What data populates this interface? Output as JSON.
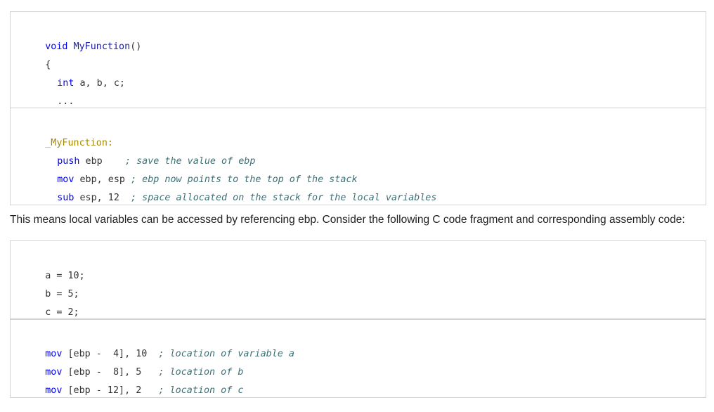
{
  "block1": {
    "line1": {
      "kw": "void",
      "fn": "MyFunction",
      "rest": "()"
    },
    "line2": "{",
    "line3": {
      "kw": "int",
      "rest": " a, b, c;"
    },
    "line4": "..."
  },
  "block2": {
    "label": "_MyFunction:",
    "lines": [
      {
        "op": "push",
        "args": " ebp    ",
        "comment": "; save the value of ebp"
      },
      {
        "op": "mov",
        "args": " ebp, esp ",
        "comment": "; ebp now points to the top of the stack"
      },
      {
        "op": "sub",
        "args": " esp, 12  ",
        "comment": "; space allocated on the stack for the local variables"
      }
    ]
  },
  "paragraph": "This means local variables can be accessed by referencing ebp. Consider the following C code fragment and corresponding assembly code:",
  "block3": {
    "lines": [
      {
        "var": "a",
        "eq": " = ",
        "val": "10;"
      },
      {
        "var": "b",
        "eq": " = ",
        "val": "5;"
      },
      {
        "var": "c",
        "eq": " = ",
        "val": "2;"
      }
    ]
  },
  "block4": {
    "lines": [
      {
        "op": "mov",
        "args": " [ebp -  4], 10  ",
        "comment": "; location of variable a"
      },
      {
        "op": "mov",
        "args": " [ebp -  8], 5   ",
        "comment": "; location of b"
      },
      {
        "op": "mov",
        "args": " [ebp - 12], 2   ",
        "comment": "; location of c"
      }
    ]
  }
}
